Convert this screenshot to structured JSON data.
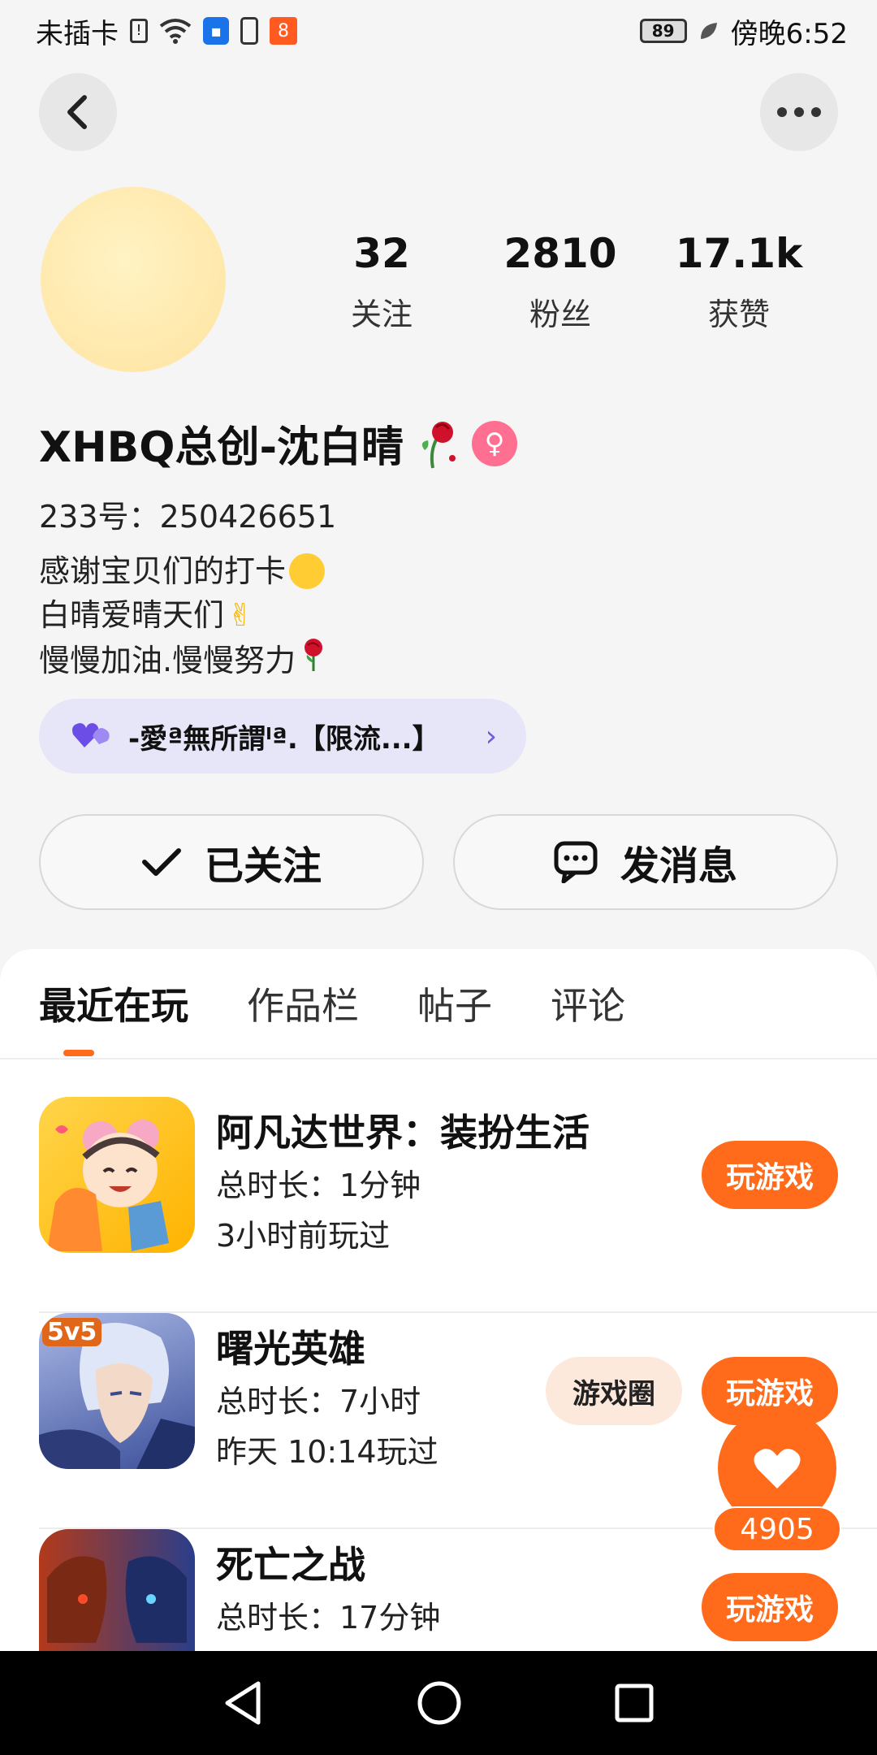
{
  "status_bar": {
    "carrier": "未插卡",
    "battery": "89",
    "time": "傍晚6:52"
  },
  "profile": {
    "stats": [
      {
        "value": "32",
        "label": "关注"
      },
      {
        "value": "2810",
        "label": "粉丝"
      },
      {
        "value": "17.1k",
        "label": "获赞"
      }
    ],
    "username": "XHBQ总创-沈白晴",
    "id_line": "233号：250426651",
    "bio": [
      "感谢宝贝们的打卡",
      "白晴爱晴天们",
      "慢慢加油.慢慢努力"
    ],
    "group_chip": "-愛ª無所謂ˡª.【限流...】"
  },
  "actions": {
    "follow_label": "已关注",
    "message_label": "发消息"
  },
  "tabs": [
    "最近在玩",
    "作品栏",
    "帖子",
    "评论"
  ],
  "games": [
    {
      "title": "阿凡达世界：装扮生活",
      "line1": "总时长：1分钟",
      "line2": "3小时前玩过",
      "play": "玩游戏"
    },
    {
      "title": "曙光英雄",
      "line1": "总时长：7小时",
      "line2": "昨天 10:14玩过",
      "play": "玩游戏",
      "circle": "游戏圈",
      "badge": "5v5"
    },
    {
      "title": "死亡之战",
      "line1": "总时长：17分钟",
      "line2": "",
      "play": "玩游戏"
    }
  ],
  "like": {
    "count": "4905"
  },
  "colors": {
    "accent": "#ff6b1a",
    "chip_bg": "#e6e6f8"
  }
}
